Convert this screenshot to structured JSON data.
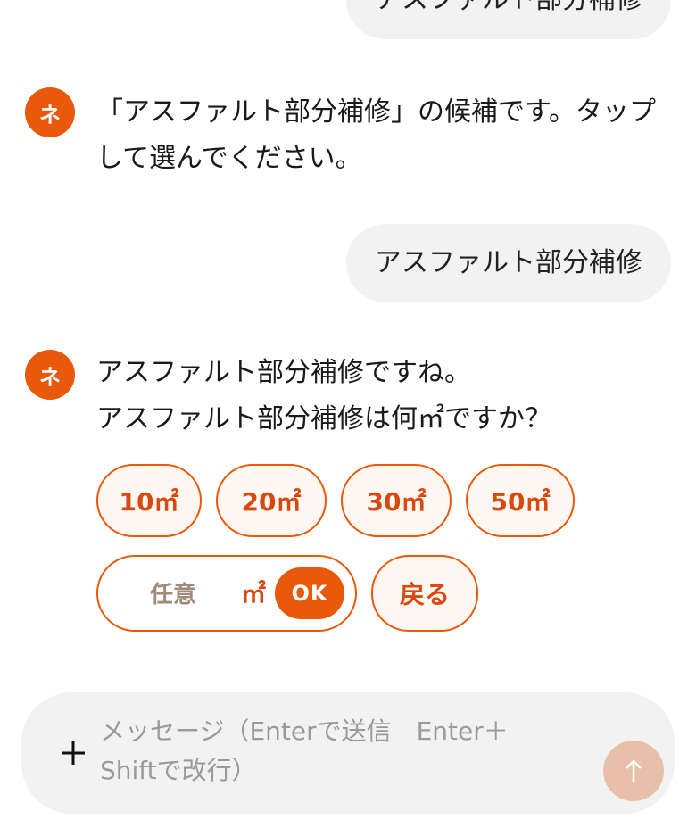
{
  "chat": {
    "messages": [
      {
        "role": "user",
        "text": "アスファルト部分補修"
      },
      {
        "role": "assistant",
        "avatar": "ネ",
        "lines": [
          "「アスファルト部分補修」の候補です。タップして選んでください。"
        ]
      },
      {
        "role": "user",
        "text": "アスファルト部分補修"
      },
      {
        "role": "assistant",
        "avatar": "ネ",
        "lines": [
          "アスファルト部分補修ですね。",
          "アスファルト部分補修は何㎡ですか？"
        ]
      }
    ],
    "options": [
      "10㎡",
      "20㎡",
      "30㎡",
      "50㎡"
    ],
    "custom": {
      "placeholder": "任意",
      "unit": "㎡",
      "ok_label": "OK"
    },
    "back_label": "戻る"
  },
  "composer": {
    "placeholder": "メッセージ（Enterで送信　Enter＋Shiftで改行）",
    "plus_icon": "plus-icon",
    "send_icon": "arrow-up-icon"
  },
  "colors": {
    "accent": "#e8590c",
    "accent_text": "#d9480f",
    "option_bg": "#fff7f2",
    "bubble_bg": "#f2f2f2",
    "send_disabled": "#e8bfa9"
  }
}
